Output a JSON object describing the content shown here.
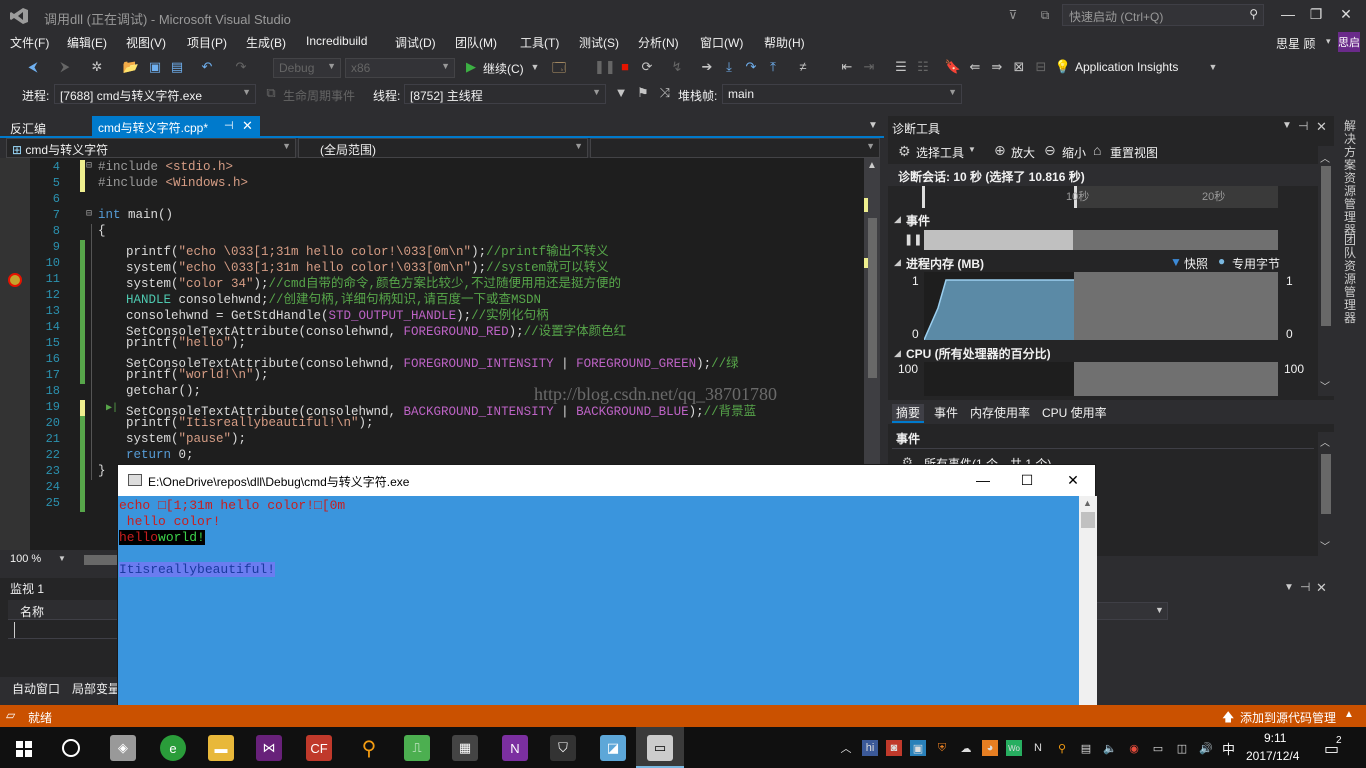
{
  "window": {
    "title": "调用dll (正在调试) - Microsoft Visual Studio",
    "quick_launch_placeholder": "快速启动 (Ctrl+Q)"
  },
  "menu": [
    "文件(F)",
    "编辑(E)",
    "视图(V)",
    "项目(P)",
    "生成(B)",
    "Incredibuild",
    "调试(D)",
    "团队(M)",
    "工具(T)",
    "测试(S)",
    "分析(N)",
    "窗口(W)",
    "帮助(H)"
  ],
  "user": {
    "name": "思星 顾",
    "avatar": "思启"
  },
  "toolbar": {
    "config": "Debug",
    "platform": "x86",
    "continue_label": "继续(C)",
    "app_insights": "Application Insights"
  },
  "debug_toolbar": {
    "process_label": "进程:",
    "process_value": "[7688] cmd与转义字符.exe",
    "lifecycle_label": "生命周期事件",
    "thread_label": "线程:",
    "thread_value": "[8752] 主线程",
    "stack_label": "堆栈帧:",
    "stack_value": "main"
  },
  "tabs": {
    "disasm": "反汇编",
    "active": "cmd与转义字符.cpp*",
    "pin": "⊣",
    "close": "✕"
  },
  "nav": {
    "project": "cmd与转义字符",
    "scope": "(全局范围)"
  },
  "code": {
    "line_numbers": [
      "4",
      "5",
      "6",
      "7",
      "8",
      "9",
      "10",
      "11",
      "12",
      "13",
      "14",
      "15",
      "16",
      "17",
      "18",
      "19",
      "20",
      "21",
      "22",
      "23",
      "24",
      "25"
    ],
    "l4": [
      "#include ",
      "<stdio.h>"
    ],
    "l5": [
      "#include ",
      "<Windows.h>"
    ],
    "l7": [
      "int",
      " main()"
    ],
    "l8": "{",
    "l9": [
      "printf(",
      "\"echo \\033[1;31m hello color!\\033[0m\\n\"",
      ");",
      "//printf输出不转义"
    ],
    "l10": [
      "system(",
      "\"echo \\033[1;31m hello color!\\033[0m\\n\"",
      ");",
      "//system就可以转义"
    ],
    "l11": [
      "system(",
      "\"color 34\"",
      ");",
      "//cmd自带的命令,颜色方案比较少,不过随便用用还是挺方便的"
    ],
    "l12": [
      "HANDLE",
      " consolehwnd;",
      "//创建句柄,详细句柄知识,请百度一下或查MSDN"
    ],
    "l13": [
      "consolehwnd = GetStdHandle(",
      "STD_OUTPUT_HANDLE",
      ");",
      "//实例化句柄"
    ],
    "l14": [
      "SetConsoleTextAttribute(consolehwnd, ",
      "FOREGROUND_RED",
      ");",
      "//设置字体颜色红"
    ],
    "l15": [
      "printf(",
      "\"hello\"",
      ");"
    ],
    "l16": [
      "SetConsoleTextAttribute(consolehwnd, ",
      "FOREGROUND_INTENSITY",
      " | ",
      "FOREGROUND_GREEN",
      ");",
      "//绿"
    ],
    "l17": [
      "printf(",
      "\"world!\\n\"",
      ");"
    ],
    "l18": "getchar();",
    "l19": [
      "SetConsoleTextAttribute(consolehwnd, ",
      "BACKGROUND_INTENSITY",
      " | ",
      "BACKGROUND_BLUE",
      ");",
      "//背景蓝"
    ],
    "l20": [
      "printf(",
      "\"Itisreallybeautiful!\\n\"",
      ");"
    ],
    "l21": [
      "system(",
      "\"pause\"",
      ");"
    ],
    "l22": [
      "return",
      " 0;"
    ],
    "l23": "}",
    "watermark": "http://blog.csdn.net/qq_38701780",
    "zoom": "100 %"
  },
  "watch": {
    "title": "监视 1",
    "col_name": "名称",
    "bottom_tabs": [
      "自动窗口",
      "局部变量"
    ]
  },
  "diagnostics": {
    "title": "诊断工具",
    "select_tool": "选择工具",
    "zoom_in": "放大",
    "zoom_out": "缩小",
    "reset_view": "重置视图",
    "session": "诊断会话: 10 秒 (选择了 10.816 秒)",
    "tick_10": "10秒",
    "tick_20": "20秒",
    "events_title": "事件",
    "memory_title": "进程内存 (MB)",
    "legend_snapshot": "快照",
    "legend_private": "专用字节",
    "mem_max": "1",
    "mem_min": "0",
    "cpu_title": "CPU (所有处理器的百分比)",
    "cpu_max": "100",
    "tabs": [
      "摘要",
      "事件",
      "内存使用率",
      "CPU 使用率"
    ],
    "events_section": "事件",
    "all_events": "所有事件(1 个，共 1 个)"
  },
  "side_tabs": [
    "解决方案资源管理器",
    "团队资源管理器"
  ],
  "console": {
    "title": "E:\\OneDrive\\repos\\dll\\Debug\\cmd与转义字符.exe",
    "line1": "echo □[1;31m hello color!□[0m",
    "line2": " hello color!",
    "hello": "hello",
    "world": "world!",
    "beautiful": "Itisreallybeautiful!"
  },
  "status": {
    "left": "就绪",
    "right": "添加到源代码管理"
  },
  "taskbar": {
    "time": "9:11",
    "date": "2017/12/4",
    "ime": "中",
    "notifications": "2"
  },
  "colors": {
    "accent": "#007acc",
    "statusbar": "#ca5100",
    "console_bg": "#3a95dd"
  }
}
